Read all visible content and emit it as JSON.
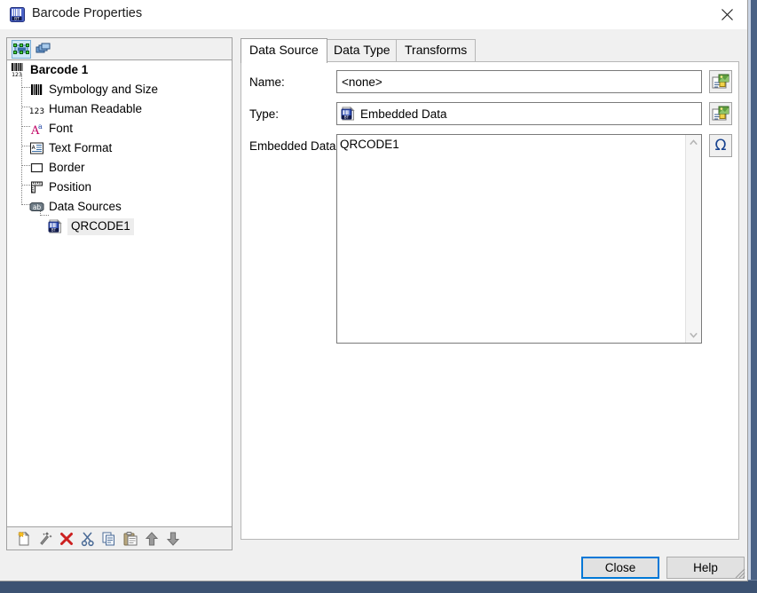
{
  "window": {
    "title": "Barcode Properties",
    "icon": "barcode-icon",
    "close_icon": "close-icon"
  },
  "left_pane": {
    "toolbar": [
      {
        "name": "selected-object-button",
        "icon": "selected-object-icon",
        "pressed": true
      },
      {
        "name": "all-objects-button",
        "icon": "layers-icon",
        "pressed": false
      }
    ],
    "tree": [
      {
        "label": "Barcode 1",
        "icon": "barcode-123-icon",
        "level": 0,
        "bold": true,
        "selected": false
      },
      {
        "label": "Symbology and Size",
        "icon": "barcode-bars-icon",
        "level": 1,
        "bold": false,
        "selected": false
      },
      {
        "label": "Human Readable",
        "icon": "digits-123-icon",
        "level": 1,
        "bold": false,
        "selected": false
      },
      {
        "label": "Font",
        "icon": "font-A-icon",
        "level": 1,
        "bold": false,
        "selected": false
      },
      {
        "label": "Text Format",
        "icon": "text-format-icon",
        "level": 1,
        "bold": false,
        "selected": false
      },
      {
        "label": "Border",
        "icon": "border-square-icon",
        "level": 1,
        "bold": false,
        "selected": false
      },
      {
        "label": "Position",
        "icon": "ruler-position-icon",
        "level": 1,
        "bold": false,
        "selected": false
      },
      {
        "label": "Data Sources",
        "icon": "ab-data-sources-icon",
        "level": 1,
        "bold": false,
        "selected": false
      },
      {
        "label": "QRCODE1",
        "icon": "embedded-data-icon",
        "level": 2,
        "bold": false,
        "selected": true
      }
    ],
    "footer_buttons": [
      {
        "name": "new-data-source-button",
        "icon": "new-document-icon"
      },
      {
        "name": "data-source-wizard-button",
        "icon": "magic-wand-icon"
      },
      {
        "name": "delete-button",
        "icon": "red-x-icon"
      },
      {
        "name": "cut-button",
        "icon": "scissors-icon"
      },
      {
        "name": "copy-button",
        "icon": "copy-icon"
      },
      {
        "name": "paste-button",
        "icon": "paste-icon"
      },
      {
        "name": "move-up-button",
        "icon": "arrow-up-icon"
      },
      {
        "name": "move-down-button",
        "icon": "arrow-down-icon"
      }
    ]
  },
  "tabs": [
    {
      "label": "Data Source",
      "active": true
    },
    {
      "label": "Data Type",
      "active": false
    },
    {
      "label": "Transforms",
      "active": false
    }
  ],
  "form": {
    "name_label": "Name:",
    "name_value": "<none>",
    "name_placeholder": "",
    "type_label": "Type:",
    "type_value": "Embedded Data",
    "type_icon": "embedded-data-icon",
    "embedded_label": "Embedded Data:",
    "embedded_value": "QRCODE1",
    "embedded_placeholder": "",
    "name_browse_icon": "data-source-wizard-icon",
    "type_browse_icon": "data-source-wizard-icon",
    "special_char_icon": "omega-icon",
    "scroll_up_icon": "chevron-up-icon",
    "scroll_down_icon": "chevron-down-icon"
  },
  "footer": {
    "close_label": "Close",
    "help_label": "Help"
  },
  "colors": {
    "accent": "#0078d7",
    "dialog_bg": "#f0f0f0",
    "panel_bg": "#ffffff",
    "desktop": "#3c5272"
  }
}
